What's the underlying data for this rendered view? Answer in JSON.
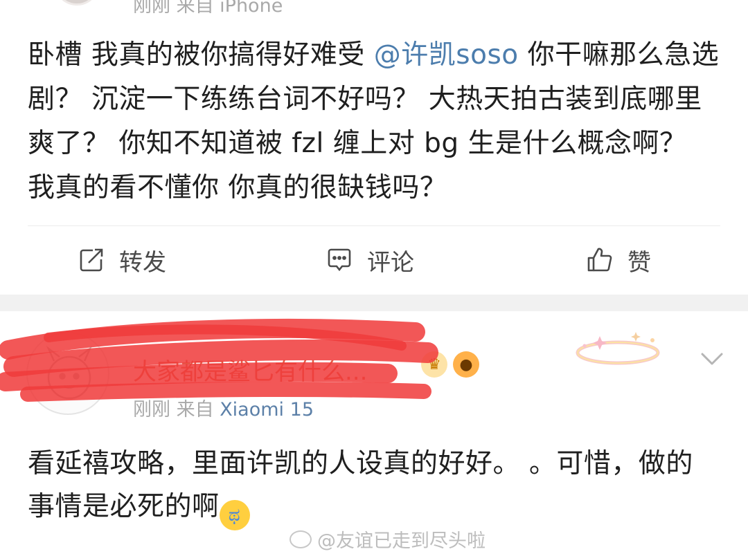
{
  "top_post": {
    "meta": "刚刚 来自 iPhone",
    "text_before": "卧槽 我真的被你搞得好难受 ",
    "mention": "@许凯soso",
    "text_after": " 你干嘛那么急选剧？ 沉淀一下练练台词不好吗？ 大热天拍古装到底哪里爽了？ 你知不知道被 fzl 缠上对 bg 生是什么概念啊？ 我真的看不懂你 你真的很缺钱吗？",
    "actions": {
      "repost": "转发",
      "comment": "评论",
      "like": "赞"
    }
  },
  "comment": {
    "username": "大家都是鲨匕有什么...",
    "time": "刚刚",
    "source_prefix": "来自",
    "device": "Xiaomi 15",
    "text": "看延禧攻略，里面许凯的人设真的好好。 。可惜，做的事情是必死的啊",
    "emoji": "crying-face-icon"
  },
  "watermark": "@友谊已走到尽头啦",
  "colors": {
    "mention": "#4c7dad",
    "username": "#e35b45",
    "redaction": "#f03b3b",
    "meta": "#a9a9a9"
  }
}
